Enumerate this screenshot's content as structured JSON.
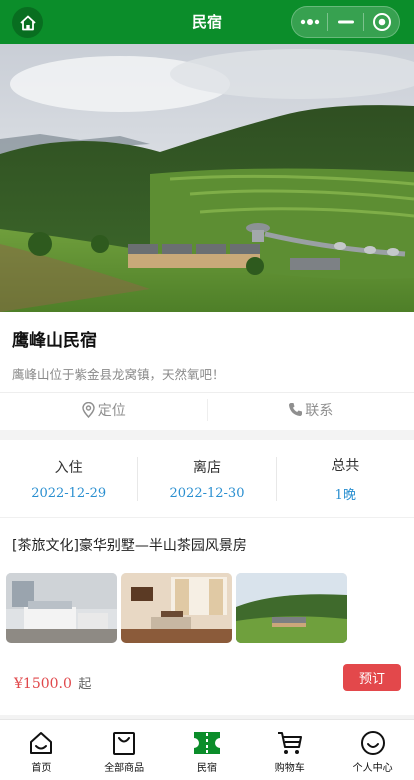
{
  "header": {
    "title": "民宿"
  },
  "listing": {
    "name": "鹰峰山民宿",
    "description": "鹰峰山位于紫金县龙窝镇，天然氧吧！",
    "actions": [
      {
        "label": "定位",
        "icon": "location-icon"
      },
      {
        "label": "联系",
        "icon": "phone-icon"
      }
    ]
  },
  "stay": {
    "checkin": {
      "label": "入住",
      "value": "2022-12-29"
    },
    "checkout": {
      "label": "离店",
      "value": "2022-12-30"
    },
    "total": {
      "label": "总共",
      "value": "1晚"
    }
  },
  "room": {
    "title": "[茶旅文化]豪华别墅—半山茶园风景房",
    "price": "¥1500.0",
    "price_suffix": "起",
    "book_label": "预订"
  },
  "tabs": [
    {
      "label": "首页",
      "icon": "home-icon"
    },
    {
      "label": "全部商品",
      "icon": "shopping-bag-icon"
    },
    {
      "label": "民宿",
      "icon": "ticket-icon",
      "active": true
    },
    {
      "label": "购物车",
      "icon": "cart-icon"
    },
    {
      "label": "个人中心",
      "icon": "smiley-icon"
    }
  ],
  "colors": {
    "brand": "#0b8d2a",
    "price": "#e0484b",
    "date": "#2a8fd0"
  }
}
